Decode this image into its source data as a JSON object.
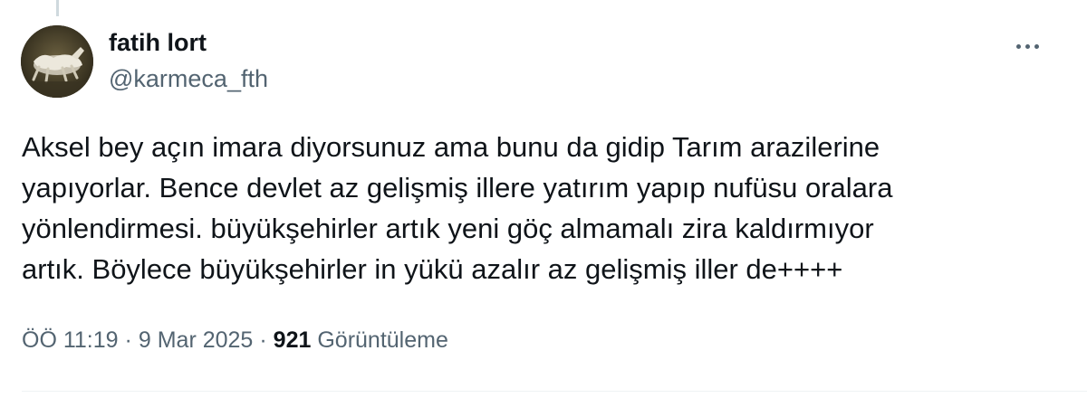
{
  "tweet": {
    "author": {
      "name": "fatih lort",
      "handle": "@karmeca_fth"
    },
    "more_icon": "ellipsis-icon",
    "text": "Aksel bey açın imara diyorsunuz ama bunu da gidip Tarım arazilerine\nyapıyorlar. Bence devlet az gelişmiş illere yatırım yapıp nufüsu  oralara\nyönlendirmesi. büyükşehirler artık yeni göç almamalı zira kaldırmıyor\nartık. Böylece büyükşehirler in yükü azalır az gelişmiş iller de++++",
    "meta": {
      "time": "ÖÖ 11:19",
      "separator": "·",
      "date": "9 Mar 2025",
      "views_count": "921",
      "views_label": "Görüntüleme"
    }
  },
  "colors": {
    "primary_text": "#0f1419",
    "secondary_text": "#536471",
    "thread_line": "#cfd9de",
    "divider": "#eff3f4"
  }
}
